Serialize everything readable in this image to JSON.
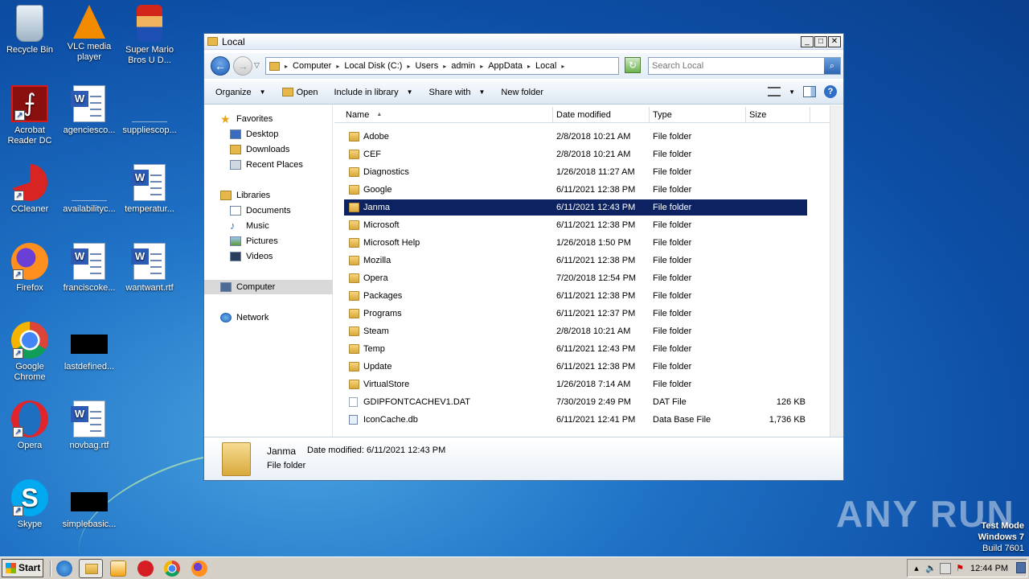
{
  "desktop": {
    "icons": [
      {
        "label": "Recycle Bin"
      },
      {
        "label": "VLC media player"
      },
      {
        "label": "Super Mario Bros U D..."
      },
      {
        "label": "Acrobat Reader DC"
      },
      {
        "label": "agenciesco..."
      },
      {
        "label": "suppliescop..."
      },
      {
        "label": "CCleaner"
      },
      {
        "label": "availabilityc..."
      },
      {
        "label": "temperatur..."
      },
      {
        "label": "Firefox"
      },
      {
        "label": "franciscoke..."
      },
      {
        "label": "wantwant.rtf"
      },
      {
        "label": "Google Chrome"
      },
      {
        "label": "lastdefined..."
      },
      {
        "label": "Opera"
      },
      {
        "label": "novbag.rtf"
      },
      {
        "label": "Skype"
      },
      {
        "label": "simplebasic..."
      }
    ]
  },
  "window": {
    "title": "Local",
    "controls": {
      "minimize": "_",
      "maximize": "□",
      "close": "✕"
    }
  },
  "address": {
    "crumbs": [
      "Computer",
      "Local Disk (C:)",
      "Users",
      "admin",
      "AppData",
      "Local"
    ],
    "search_placeholder": "Search Local"
  },
  "toolbar": {
    "organize": "Organize",
    "open": "Open",
    "include": "Include in library",
    "share": "Share with",
    "new_folder": "New folder"
  },
  "navpane": {
    "favorites": "Favorites",
    "desktop": "Desktop",
    "downloads": "Downloads",
    "recent": "Recent Places",
    "libraries": "Libraries",
    "documents": "Documents",
    "music": "Music",
    "pictures": "Pictures",
    "videos": "Videos",
    "computer": "Computer",
    "network": "Network"
  },
  "columns": {
    "name": "Name",
    "date": "Date modified",
    "type": "Type",
    "size": "Size"
  },
  "files": [
    {
      "name": "Adobe",
      "date": "2/8/2018 10:21 AM",
      "type": "File folder",
      "size": ""
    },
    {
      "name": "CEF",
      "date": "2/8/2018 10:21 AM",
      "type": "File folder",
      "size": ""
    },
    {
      "name": "Diagnostics",
      "date": "1/26/2018 11:27 AM",
      "type": "File folder",
      "size": ""
    },
    {
      "name": "Google",
      "date": "6/11/2021 12:38 PM",
      "type": "File folder",
      "size": ""
    },
    {
      "name": "Janma",
      "date": "6/11/2021 12:43 PM",
      "type": "File folder",
      "size": ""
    },
    {
      "name": "Microsoft",
      "date": "6/11/2021 12:38 PM",
      "type": "File folder",
      "size": ""
    },
    {
      "name": "Microsoft Help",
      "date": "1/26/2018 1:50 PM",
      "type": "File folder",
      "size": ""
    },
    {
      "name": "Mozilla",
      "date": "6/11/2021 12:38 PM",
      "type": "File folder",
      "size": ""
    },
    {
      "name": "Opera",
      "date": "7/20/2018 12:54 PM",
      "type": "File folder",
      "size": ""
    },
    {
      "name": "Packages",
      "date": "6/11/2021 12:38 PM",
      "type": "File folder",
      "size": ""
    },
    {
      "name": "Programs",
      "date": "6/11/2021 12:37 PM",
      "type": "File folder",
      "size": ""
    },
    {
      "name": "Steam",
      "date": "2/8/2018 10:21 AM",
      "type": "File folder",
      "size": ""
    },
    {
      "name": "Temp",
      "date": "6/11/2021 12:43 PM",
      "type": "File folder",
      "size": ""
    },
    {
      "name": "Update",
      "date": "6/11/2021 12:38 PM",
      "type": "File folder",
      "size": ""
    },
    {
      "name": "VirtualStore",
      "date": "1/26/2018 7:14 AM",
      "type": "File folder",
      "size": ""
    },
    {
      "name": "GDIPFONTCACHEV1.DAT",
      "date": "7/30/2019 2:49 PM",
      "type": "DAT File",
      "size": "126 KB"
    },
    {
      "name": "IconCache.db",
      "date": "6/11/2021 12:41 PM",
      "type": "Data Base File",
      "size": "1,736 KB"
    }
  ],
  "selected_file": "Janma",
  "details": {
    "name": "Janma",
    "modified": "Date modified: 6/11/2021 12:43 PM",
    "type": "File folder"
  },
  "watermark": "ANY RUN",
  "test_mode": {
    "line1": "Test Mode",
    "line2": "Windows 7",
    "line3": "Build 7601"
  },
  "taskbar": {
    "start": "Start",
    "clock": "12:44 PM"
  }
}
